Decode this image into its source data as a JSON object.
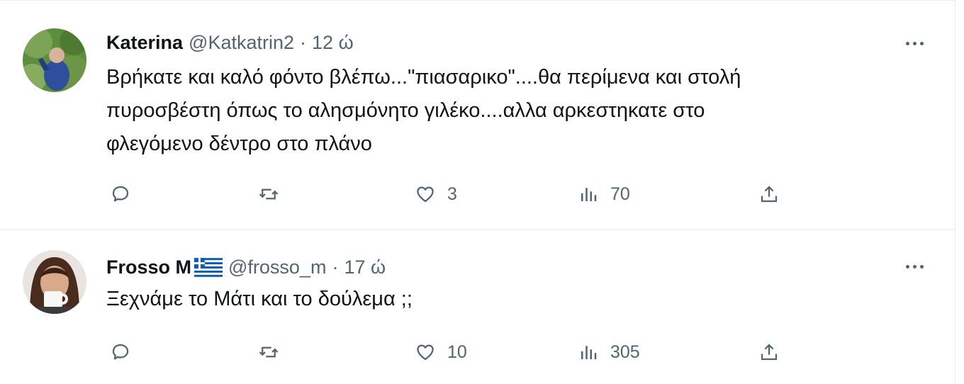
{
  "tweets": [
    {
      "name": "Katerina",
      "handle": "@Katkatrin2",
      "separator": "·",
      "time": "12 ώ",
      "text": "Βρήκατε και καλό φόντο βλέπω...\"πιασαρικο\"....θα περίμενα και στολή\nπυροσβέστη όπως το αλησμόνητο γιλέκο....αλλα αρκεστηκατε στο\nφλεγόμενο δέντρο στο πλάνο",
      "reply_count": "",
      "retweet_count": "",
      "like_count": "3",
      "view_count": "70",
      "icons": [
        "more-icon",
        "reply-icon",
        "retweet-icon",
        "like-icon",
        "views-icon",
        "share-icon"
      ]
    },
    {
      "name": "Frosso M",
      "flag": "greek-flag",
      "handle": "@frosso_m",
      "separator": "·",
      "time": "17 ώ",
      "text": "Ξεχνάμε το Μάτι και το δούλεμα ;;",
      "reply_count": "",
      "retweet_count": "",
      "like_count": "10",
      "view_count": "305",
      "icons": [
        "more-icon",
        "reply-icon",
        "retweet-icon",
        "like-icon",
        "views-icon",
        "share-icon"
      ]
    }
  ],
  "colors": {
    "text": "#0f1419",
    "secondary": "#536471",
    "border": "#eff3f4",
    "flag_blue": "#0d5eaf"
  }
}
